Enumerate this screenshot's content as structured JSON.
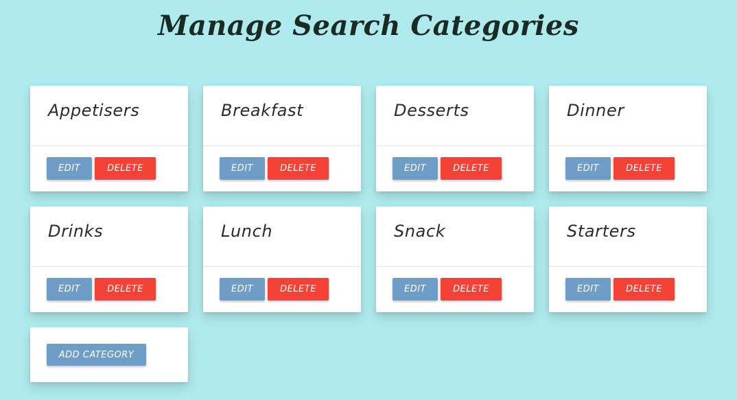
{
  "page": {
    "title": "Manage Search Categories"
  },
  "categories": [
    {
      "name": "Appetisers",
      "edit_label": "EDIT",
      "delete_label": "DELETE"
    },
    {
      "name": "Breakfast",
      "edit_label": "EDIT",
      "delete_label": "DELETE"
    },
    {
      "name": "Desserts",
      "edit_label": "EDIT",
      "delete_label": "DELETE"
    },
    {
      "name": "Dinner",
      "edit_label": "EDIT",
      "delete_label": "DELETE"
    },
    {
      "name": "Drinks",
      "edit_label": "EDIT",
      "delete_label": "DELETE"
    },
    {
      "name": "Lunch",
      "edit_label": "EDIT",
      "delete_label": "DELETE"
    },
    {
      "name": "Snack",
      "edit_label": "EDIT",
      "delete_label": "DELETE"
    },
    {
      "name": "Starters",
      "edit_label": "EDIT",
      "delete_label": "DELETE"
    }
  ],
  "add_category": {
    "label": "ADD CATEGORY"
  },
  "colors": {
    "background": "#afebee",
    "edit_button": "#6f9dc5",
    "delete_button": "#f44336",
    "card": "#ffffff",
    "title_text": "#1b2a22"
  }
}
